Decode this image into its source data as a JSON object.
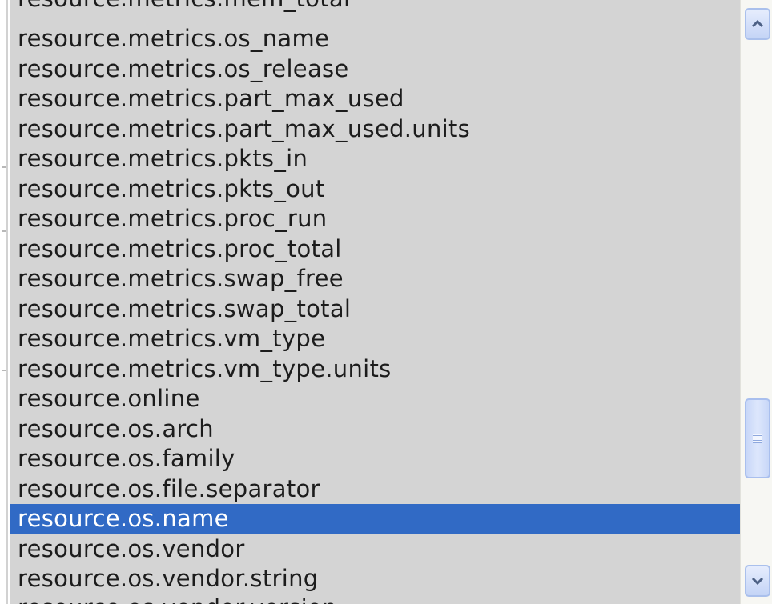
{
  "listbox": {
    "items": [
      "resource.metrics.mem_total",
      "resource.metrics.os_name",
      "resource.metrics.os_release",
      "resource.metrics.part_max_used",
      "resource.metrics.part_max_used.units",
      "resource.metrics.pkts_in",
      "resource.metrics.pkts_out",
      "resource.metrics.proc_run",
      "resource.metrics.proc_total",
      "resource.metrics.swap_free",
      "resource.metrics.swap_total",
      "resource.metrics.vm_type",
      "resource.metrics.vm_type.units",
      "resource.online",
      "resource.os.arch",
      "resource.os.family",
      "resource.os.file.separator",
      "resource.os.name",
      "resource.os.vendor",
      "resource.os.vendor.string",
      "resource.os.vendor.version"
    ],
    "selected_item": "resource.os.name"
  },
  "scrollbar": {
    "up_icon": "chevron-up-icon",
    "down_icon": "chevron-down-icon",
    "thumb_grip_icon": "grip-icon"
  },
  "colors": {
    "list_background": "#d4d4d4",
    "selection_background": "#316ac5",
    "selection_text": "#ffffff",
    "item_text": "#1c1c1c",
    "scrollbar_accent": "#aac0ec"
  }
}
